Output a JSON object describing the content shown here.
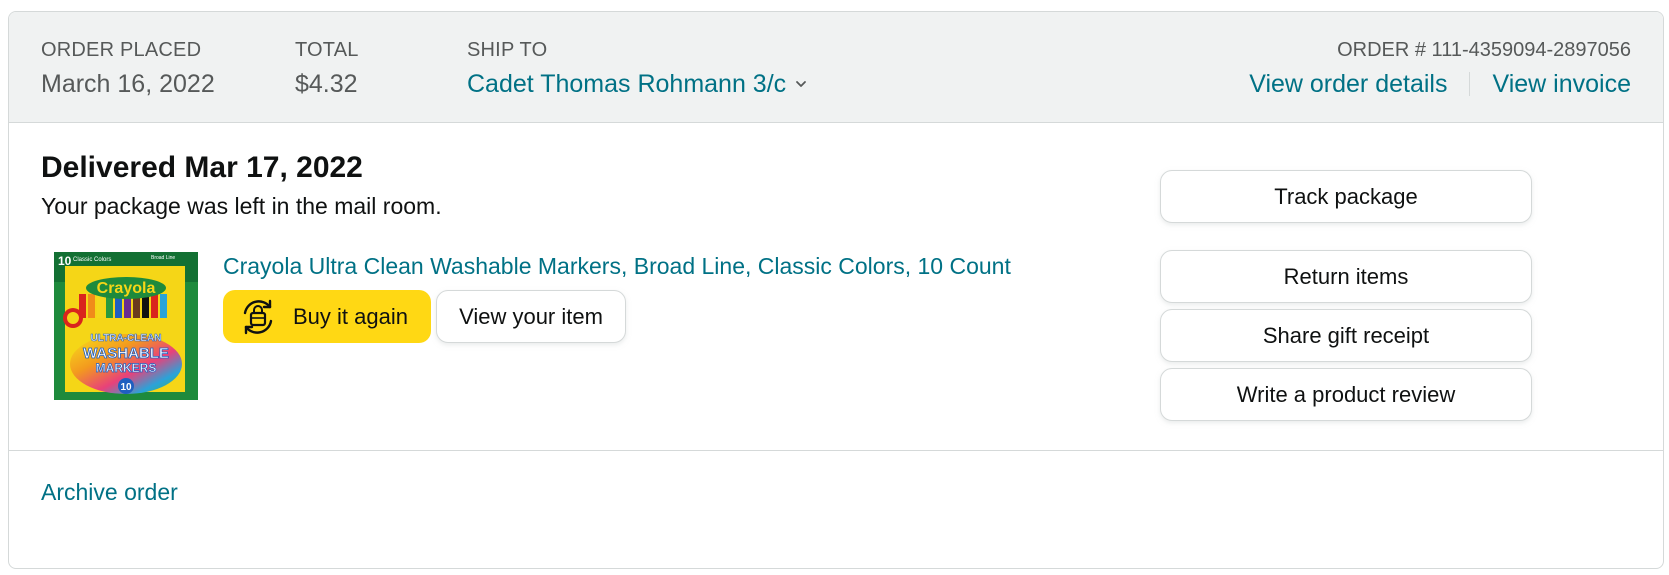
{
  "header": {
    "order_placed_label": "ORDER PLACED",
    "order_placed_value": "March 16, 2022",
    "total_label": "TOTAL",
    "total_value": "$4.32",
    "ship_to_label": "SHIP TO",
    "ship_to_value": "Cadet Thomas Rohmann 3/c",
    "order_number": "ORDER # 111-4359094-2897056",
    "view_order_details": "View order details",
    "view_invoice": "View invoice"
  },
  "shipment": {
    "status_title": "Delivered Mar 17, 2022",
    "status_detail": "Your package was left in the mail room."
  },
  "item": {
    "title": "Crayola Ultra Clean Washable Markers, Broad Line, Classic Colors, 10 Count",
    "buy_again_label": "Buy it again",
    "view_item_label": "View your item",
    "image_text": {
      "count_top": "10",
      "classic": "Classic Colors",
      "broad_line": "Broad Line",
      "brand": "Crayola",
      "line1": "ULTRA-CLEAN",
      "line2": "WASHABLE",
      "line3": "MARKERS",
      "count_bottom": "10"
    }
  },
  "actions": [
    "Track package",
    "Return items",
    "Share gift receipt",
    "Write a product review"
  ],
  "footer": {
    "archive_label": "Archive order"
  },
  "colors": {
    "link": "#007185",
    "header_bg": "#f0f2f2",
    "buy_button": "#ffd814",
    "border": "#d5d9d9"
  },
  "icons": {
    "buy_again": "reorder-bag-icon",
    "ship_to_dropdown": "chevron-down-icon"
  }
}
